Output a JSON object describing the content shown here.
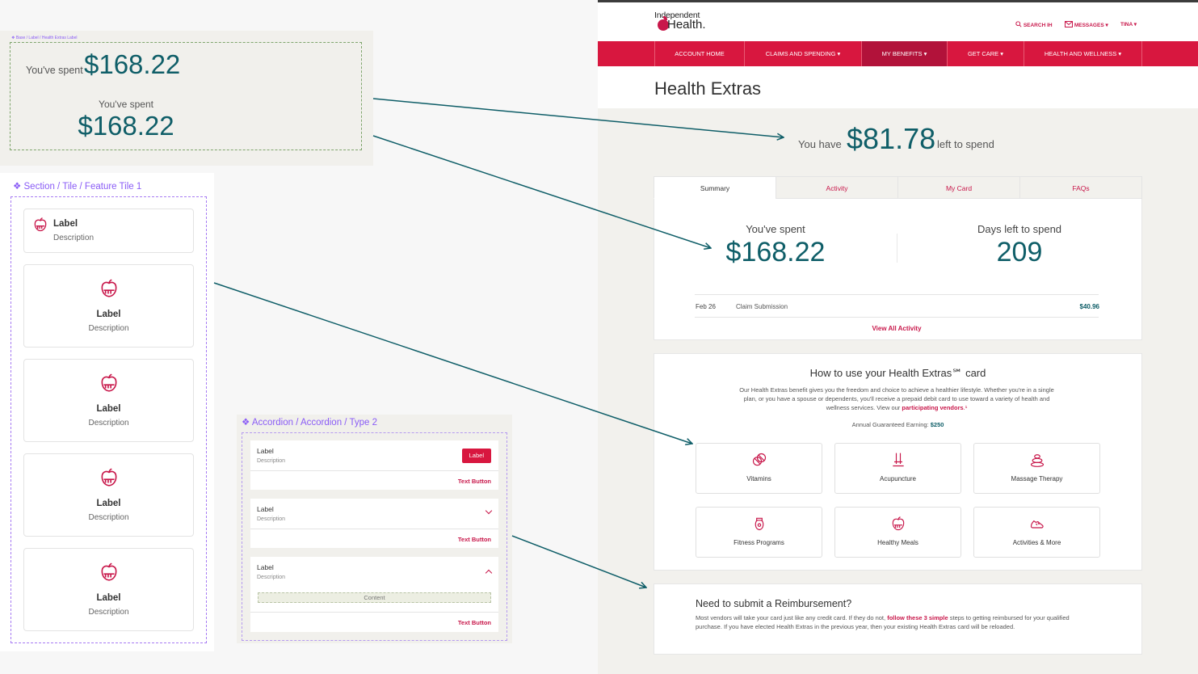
{
  "label_frame": {
    "breadcrumb": "❖ Base / Label / Health Extras Label",
    "inline_label": "You've spent",
    "inline_amount": "$168.22",
    "center_label": "You've spent",
    "center_amount": "$168.22"
  },
  "tile_frame": {
    "title": "❖ Section / Tile / Feature Tile 1",
    "tiles": [
      {
        "label": "Label",
        "description": "Description"
      },
      {
        "label": "Label",
        "description": "Description"
      },
      {
        "label": "Label",
        "description": "Description"
      },
      {
        "label": "Label",
        "description": "Description"
      },
      {
        "label": "Label",
        "description": "Description"
      }
    ],
    "icon": "apple-icon"
  },
  "accordion_frame": {
    "title": "❖ Accordion / Accordion / Type 2",
    "items": [
      {
        "label": "Label",
        "description": "Description",
        "badge": "Label",
        "button": "Text Button"
      },
      {
        "label": "Label",
        "description": "Description",
        "button": "Text Button"
      },
      {
        "label": "Label",
        "description": "Description",
        "content": "Content",
        "button": "Text Button"
      }
    ]
  },
  "site": {
    "logo_top": "Independent",
    "logo_bottom": "Health.",
    "header": {
      "search": "SEARCH IH",
      "messages": "MESSAGES",
      "user": "TINA"
    },
    "nav": [
      "ACCOUNT HOME",
      "CLAIMS AND SPENDING",
      "MY BENEFITS",
      "GET CARE",
      "HEALTH AND WELLNESS"
    ],
    "nav_active": "MY BENEFITS",
    "page_title": "Health Extras",
    "balance": {
      "prefix": "You have",
      "amount": "$81.78",
      "suffix": "left to spend"
    },
    "tabs": [
      "Summary",
      "Activity",
      "My Card",
      "FAQs"
    ],
    "active_tab": "Summary",
    "summary": {
      "spent_label": "You've spent",
      "spent_amount": "$168.22",
      "days_label": "Days left to spend",
      "days_amount": "209"
    },
    "activity": [
      {
        "date": "Feb 26",
        "description": "Claim Submission",
        "amount": "$40.96"
      }
    ],
    "view_all": "View All Activity",
    "howto": {
      "title": "How to use your Health Extras℠ card",
      "body": "Our Health Extras benefit gives you the freedom and choice to achieve a healthier lifestyle. Whether you're in a single plan, or you have a spouse or dependents, you'll receive a prepaid debit card to use toward a variety of health and wellness services. View our",
      "link": "participating vendors",
      "body_end": ".¹",
      "earning_label": "Annual Guaranteed Earning:",
      "earning_value": "$250"
    },
    "services": [
      {
        "label": "Vitamins",
        "icon": "vitamins-icon"
      },
      {
        "label": "Acupuncture",
        "icon": "acupuncture-icon"
      },
      {
        "label": "Massage Therapy",
        "icon": "massage-icon"
      },
      {
        "label": "Fitness Programs",
        "icon": "fitness-icon"
      },
      {
        "label": "Healthy Meals",
        "icon": "apple-icon"
      },
      {
        "label": "Activities & More",
        "icon": "shoe-icon"
      }
    ],
    "reimbursement": {
      "title": "Need to submit a Reimbursement?",
      "body_start": "Most vendors will take your card just like any credit card. If they do not,",
      "link": "follow these 3 simple",
      "body_end": "steps to getting reimbursed for your qualified purchase. If you have elected Health Extras in the previous year, then your existing Health Extras card will be reloaded."
    }
  },
  "colors": {
    "brand": "#c8174a",
    "nav": "#d8173f",
    "teal": "#0f5e68",
    "annotation": "#8a5cf6"
  }
}
